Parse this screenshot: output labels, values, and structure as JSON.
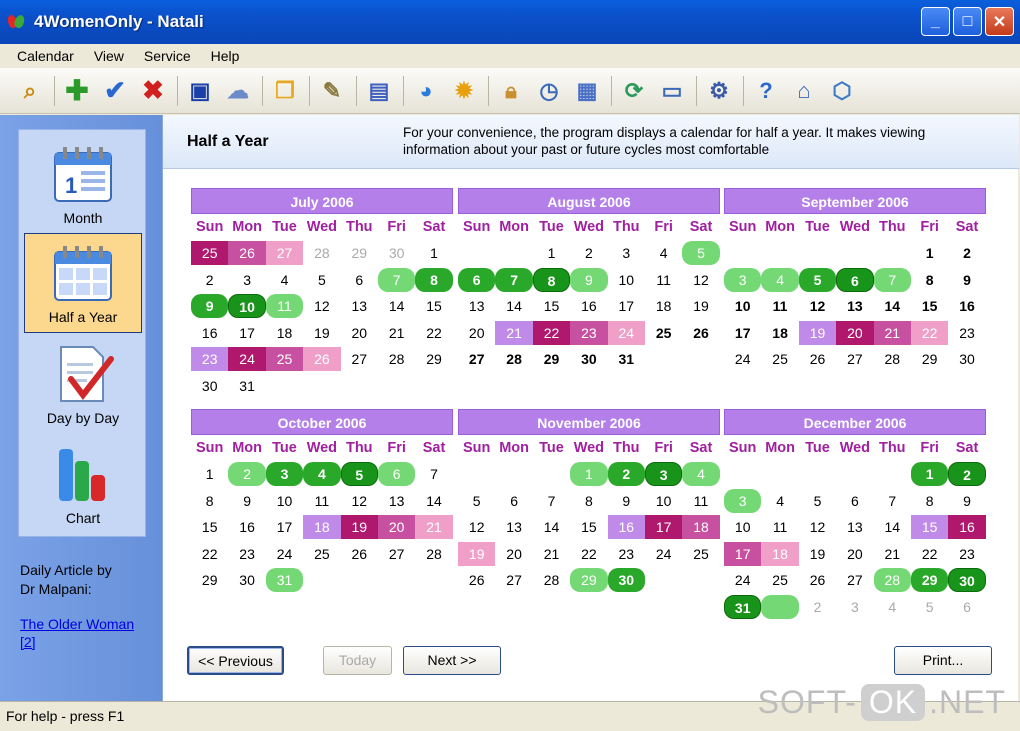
{
  "window": {
    "title": "4WomenOnly - Natali"
  },
  "menu": [
    "Calendar",
    "View",
    "Service",
    "Help"
  ],
  "toolbar": [
    "zoom-icon",
    "add-icon",
    "check-icon",
    "delete-icon",
    "save-icon",
    "cloud-icon",
    "folders-icon",
    "edit-icon",
    "chart-icon",
    "pie-icon",
    "sun-icon",
    "lock-icon",
    "clock-icon",
    "notes-icon",
    "refresh-icon",
    "window-icon",
    "gear-icon",
    "help-icon",
    "home-icon",
    "box-icon"
  ],
  "sidebar": {
    "items": [
      {
        "label": "Month",
        "icon": "calendar-month-icon"
      },
      {
        "label": "Half a Year",
        "icon": "calendar-halfyear-icon",
        "active": true
      },
      {
        "label": "Day by Day",
        "icon": "checkmark-doc-icon"
      },
      {
        "label": "Chart",
        "icon": "bar-chart-icon"
      }
    ],
    "daily_line1": "Daily Article by",
    "daily_line2": "Dr Malpani:",
    "article_line1": "The Older Woman",
    "article_line2": "[2]"
  },
  "header": {
    "title": "Half a Year",
    "desc_line1": "For your convenience, the program displays a calendar for half a year. It makes viewing",
    "desc_line2": "information about your past or future cycles most comfortable"
  },
  "weekdays": [
    "Sun",
    "Mon",
    "Tue",
    "Wed",
    "Thu",
    "Fri",
    "Sat"
  ],
  "months": [
    {
      "name": "July 2006",
      "weeks": [
        [
          [
            "25",
            "dm"
          ],
          [
            "26",
            "m"
          ],
          [
            "27",
            "p"
          ],
          [
            "28",
            "o"
          ],
          [
            "29",
            "o"
          ],
          [
            "30",
            "o"
          ],
          [
            "1",
            ""
          ]
        ],
        [
          [
            "2",
            ""
          ],
          [
            "3",
            ""
          ],
          [
            "4",
            ""
          ],
          [
            "5",
            ""
          ],
          [
            "6",
            ""
          ],
          [
            "7",
            "lg"
          ],
          [
            "8",
            "g"
          ]
        ],
        [
          [
            "9",
            "g"
          ],
          [
            "10",
            "dg"
          ],
          [
            "11",
            "lg"
          ],
          [
            "12",
            ""
          ],
          [
            "13",
            ""
          ],
          [
            "14",
            ""
          ],
          [
            "15",
            ""
          ]
        ],
        [
          [
            "16",
            ""
          ],
          [
            "17",
            ""
          ],
          [
            "18",
            ""
          ],
          [
            "19",
            ""
          ],
          [
            "20",
            ""
          ],
          [
            "21",
            ""
          ],
          [
            "22",
            ""
          ]
        ],
        [
          [
            "23",
            "v"
          ],
          [
            "24",
            "dm"
          ],
          [
            "25",
            "m"
          ],
          [
            "26",
            "p"
          ],
          [
            "27",
            ""
          ],
          [
            "28",
            ""
          ],
          [
            "29",
            ""
          ]
        ],
        [
          [
            "30",
            ""
          ],
          [
            "31",
            ""
          ]
        ]
      ]
    },
    {
      "name": "August 2006",
      "weeks": [
        [
          [
            "",
            ""
          ],
          [
            "",
            ""
          ],
          [
            "1",
            ""
          ],
          [
            "2",
            ""
          ],
          [
            "3",
            ""
          ],
          [
            "4",
            ""
          ],
          [
            "5",
            "lg"
          ]
        ],
        [
          [
            "6",
            "g"
          ],
          [
            "7",
            "g"
          ],
          [
            "8",
            "dg"
          ],
          [
            "9",
            "lg"
          ],
          [
            "10",
            ""
          ],
          [
            "11",
            ""
          ],
          [
            "12",
            ""
          ]
        ],
        [
          [
            "13",
            ""
          ],
          [
            "14",
            ""
          ],
          [
            "15",
            ""
          ],
          [
            "16",
            ""
          ],
          [
            "17",
            ""
          ],
          [
            "18",
            ""
          ],
          [
            "19",
            ""
          ]
        ],
        [
          [
            "20",
            ""
          ],
          [
            "21",
            "v"
          ],
          [
            "22",
            "dm"
          ],
          [
            "23",
            "m"
          ],
          [
            "24",
            "p"
          ],
          [
            "25",
            "b"
          ],
          [
            "26",
            "b"
          ]
        ],
        [
          [
            "27",
            "b"
          ],
          [
            "28",
            "b"
          ],
          [
            "29",
            "b"
          ],
          [
            "30",
            "b"
          ],
          [
            "31",
            "b"
          ]
        ]
      ]
    },
    {
      "name": "September 2006",
      "weeks": [
        [
          [
            "",
            ""
          ],
          [
            "",
            ""
          ],
          [
            "",
            ""
          ],
          [
            "",
            ""
          ],
          [
            "",
            ""
          ],
          [
            "1",
            "b"
          ],
          [
            "2",
            "b"
          ]
        ],
        [
          [
            "3",
            "lg"
          ],
          [
            "4",
            "lg"
          ],
          [
            "5",
            "g"
          ],
          [
            "6",
            "dg"
          ],
          [
            "7",
            "lg"
          ],
          [
            "8",
            "b"
          ],
          [
            "9",
            "b"
          ]
        ],
        [
          [
            "10",
            "b"
          ],
          [
            "11",
            "b"
          ],
          [
            "12",
            "b"
          ],
          [
            "13",
            "b"
          ],
          [
            "14",
            "b"
          ],
          [
            "15",
            "b"
          ],
          [
            "16",
            "b"
          ]
        ],
        [
          [
            "17",
            "b"
          ],
          [
            "18",
            "b"
          ],
          [
            "19",
            "v"
          ],
          [
            "20",
            "dm"
          ],
          [
            "21",
            "m"
          ],
          [
            "22",
            "p"
          ],
          [
            "23",
            ""
          ]
        ],
        [
          [
            "24",
            ""
          ],
          [
            "25",
            ""
          ],
          [
            "26",
            ""
          ],
          [
            "27",
            ""
          ],
          [
            "28",
            ""
          ],
          [
            "29",
            ""
          ],
          [
            "30",
            ""
          ]
        ]
      ]
    },
    {
      "name": "October 2006",
      "weeks": [
        [
          [
            "1",
            ""
          ],
          [
            "2",
            "lg"
          ],
          [
            "3",
            "g"
          ],
          [
            "4",
            "g"
          ],
          [
            "5",
            "dg"
          ],
          [
            "6",
            "lg"
          ],
          [
            "7",
            ""
          ]
        ],
        [
          [
            "8",
            ""
          ],
          [
            "9",
            ""
          ],
          [
            "10",
            ""
          ],
          [
            "11",
            ""
          ],
          [
            "12",
            ""
          ],
          [
            "13",
            ""
          ],
          [
            "14",
            ""
          ]
        ],
        [
          [
            "15",
            ""
          ],
          [
            "16",
            ""
          ],
          [
            "17",
            ""
          ],
          [
            "18",
            "v"
          ],
          [
            "19",
            "dm"
          ],
          [
            "20",
            "m"
          ],
          [
            "21",
            "p"
          ]
        ],
        [
          [
            "22",
            ""
          ],
          [
            "23",
            ""
          ],
          [
            "24",
            ""
          ],
          [
            "25",
            ""
          ],
          [
            "26",
            ""
          ],
          [
            "27",
            ""
          ],
          [
            "28",
            ""
          ]
        ],
        [
          [
            "29",
            ""
          ],
          [
            "30",
            ""
          ],
          [
            "31",
            "lg"
          ]
        ]
      ]
    },
    {
      "name": "November 2006",
      "weeks": [
        [
          [
            "",
            ""
          ],
          [
            "",
            ""
          ],
          [
            "",
            ""
          ],
          [
            "1",
            "lg"
          ],
          [
            "2",
            "g"
          ],
          [
            "3",
            "dg"
          ],
          [
            "4",
            "lg"
          ]
        ],
        [
          [
            "5",
            ""
          ],
          [
            "6",
            ""
          ],
          [
            "7",
            ""
          ],
          [
            "8",
            ""
          ],
          [
            "9",
            ""
          ],
          [
            "10",
            ""
          ],
          [
            "11",
            ""
          ]
        ],
        [
          [
            "12",
            ""
          ],
          [
            "13",
            ""
          ],
          [
            "14",
            ""
          ],
          [
            "15",
            ""
          ],
          [
            "16",
            "v"
          ],
          [
            "17",
            "dm"
          ],
          [
            "18",
            "m"
          ]
        ],
        [
          [
            "19",
            "p"
          ],
          [
            "20",
            ""
          ],
          [
            "21",
            ""
          ],
          [
            "22",
            ""
          ],
          [
            "23",
            ""
          ],
          [
            "24",
            ""
          ],
          [
            "25",
            ""
          ]
        ],
        [
          [
            "26",
            ""
          ],
          [
            "27",
            ""
          ],
          [
            "28",
            ""
          ],
          [
            "29",
            "lg"
          ],
          [
            "30",
            "g"
          ]
        ]
      ]
    },
    {
      "name": "December 2006",
      "weeks": [
        [
          [
            "",
            ""
          ],
          [
            "",
            ""
          ],
          [
            "",
            ""
          ],
          [
            "",
            ""
          ],
          [
            "",
            ""
          ],
          [
            "1",
            "g"
          ],
          [
            "2",
            "dg"
          ]
        ],
        [
          [
            "3",
            "lg"
          ],
          [
            "4",
            ""
          ],
          [
            "5",
            ""
          ],
          [
            "6",
            ""
          ],
          [
            "7",
            ""
          ],
          [
            "8",
            ""
          ],
          [
            "9",
            ""
          ]
        ],
        [
          [
            "10",
            ""
          ],
          [
            "11",
            ""
          ],
          [
            "12",
            ""
          ],
          [
            "13",
            ""
          ],
          [
            "14",
            ""
          ],
          [
            "15",
            "v"
          ],
          [
            "16",
            "dm"
          ]
        ],
        [
          [
            "17",
            "m"
          ],
          [
            "18",
            "p"
          ],
          [
            "19",
            ""
          ],
          [
            "20",
            ""
          ],
          [
            "21",
            ""
          ],
          [
            "22",
            ""
          ],
          [
            "23",
            ""
          ]
        ],
        [
          [
            "24",
            ""
          ],
          [
            "25",
            ""
          ],
          [
            "26",
            ""
          ],
          [
            "27",
            ""
          ],
          [
            "28",
            "lg"
          ],
          [
            "29",
            "g"
          ],
          [
            "30",
            "dg"
          ]
        ],
        [
          [
            "31",
            "dg"
          ],
          [
            "",
            "lg"
          ],
          [
            "2",
            "o"
          ],
          [
            "3",
            "o"
          ],
          [
            "4",
            "o"
          ],
          [
            "5",
            "o"
          ],
          [
            "6",
            "o"
          ]
        ]
      ]
    }
  ],
  "buttons": {
    "previous": "<< Previous",
    "today": "Today",
    "next": "Next >>",
    "print": "Print..."
  },
  "status": "For help - press F1",
  "watermark": {
    "left": "SOFT-",
    "box": "OK",
    "right": ".NET"
  }
}
